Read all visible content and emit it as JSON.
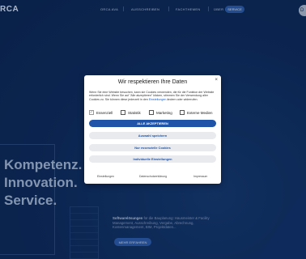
{
  "header": {
    "logo": "RCA",
    "nav": [
      "ORCA AVA",
      "AUSSCHREIBEN",
      "FACHTHEMEN",
      "ÜBER UNS"
    ],
    "service_label": "SERVICE",
    "lang_label": "D"
  },
  "hero": {
    "headline_lines": [
      "Kompetenz.",
      "Innovation.",
      "Service."
    ],
    "sw_title": "Softwarelösungen",
    "sw_text": " für die Bauplanung: Hausmeister & Facility Management, Ausschreibung, Vergabe, Abrechnung, Kostenmanagement, BIM, Projektdaten...",
    "more_label": "MEHR ERFAHREN"
  },
  "cookie": {
    "title": "Wir respektieren Ihre Daten",
    "description": "Wenn Sie eine Website besuchen, kann sie Cookies verwenden, die für die Funktion der Website erforderlich sind. Wenn Sie auf \"Alle akzeptieren\" klicken, stimmen Sie der Verwendung aller Cookies zu. Sie können diese jederzeit in den",
    "description_link": "Einstellungen",
    "description_end": " ändern oder widerrufen.",
    "options": [
      {
        "label": "Essenziell",
        "checked": true,
        "disabled": true
      },
      {
        "label": "Statistik",
        "checked": false
      },
      {
        "label": "Marketing",
        "checked": false
      },
      {
        "label": "Externe Medien",
        "checked": false
      }
    ],
    "accept_all": "ALLE AKZEPTIEREN",
    "save_selection": "Auswahl speichern",
    "only_essential": "Nur essenzielle Cookies",
    "individual_settings": "Individuelle Einstellungen",
    "footer_links": [
      "Einstellungen",
      "Datenschutzerklärung",
      "Impressum"
    ]
  }
}
